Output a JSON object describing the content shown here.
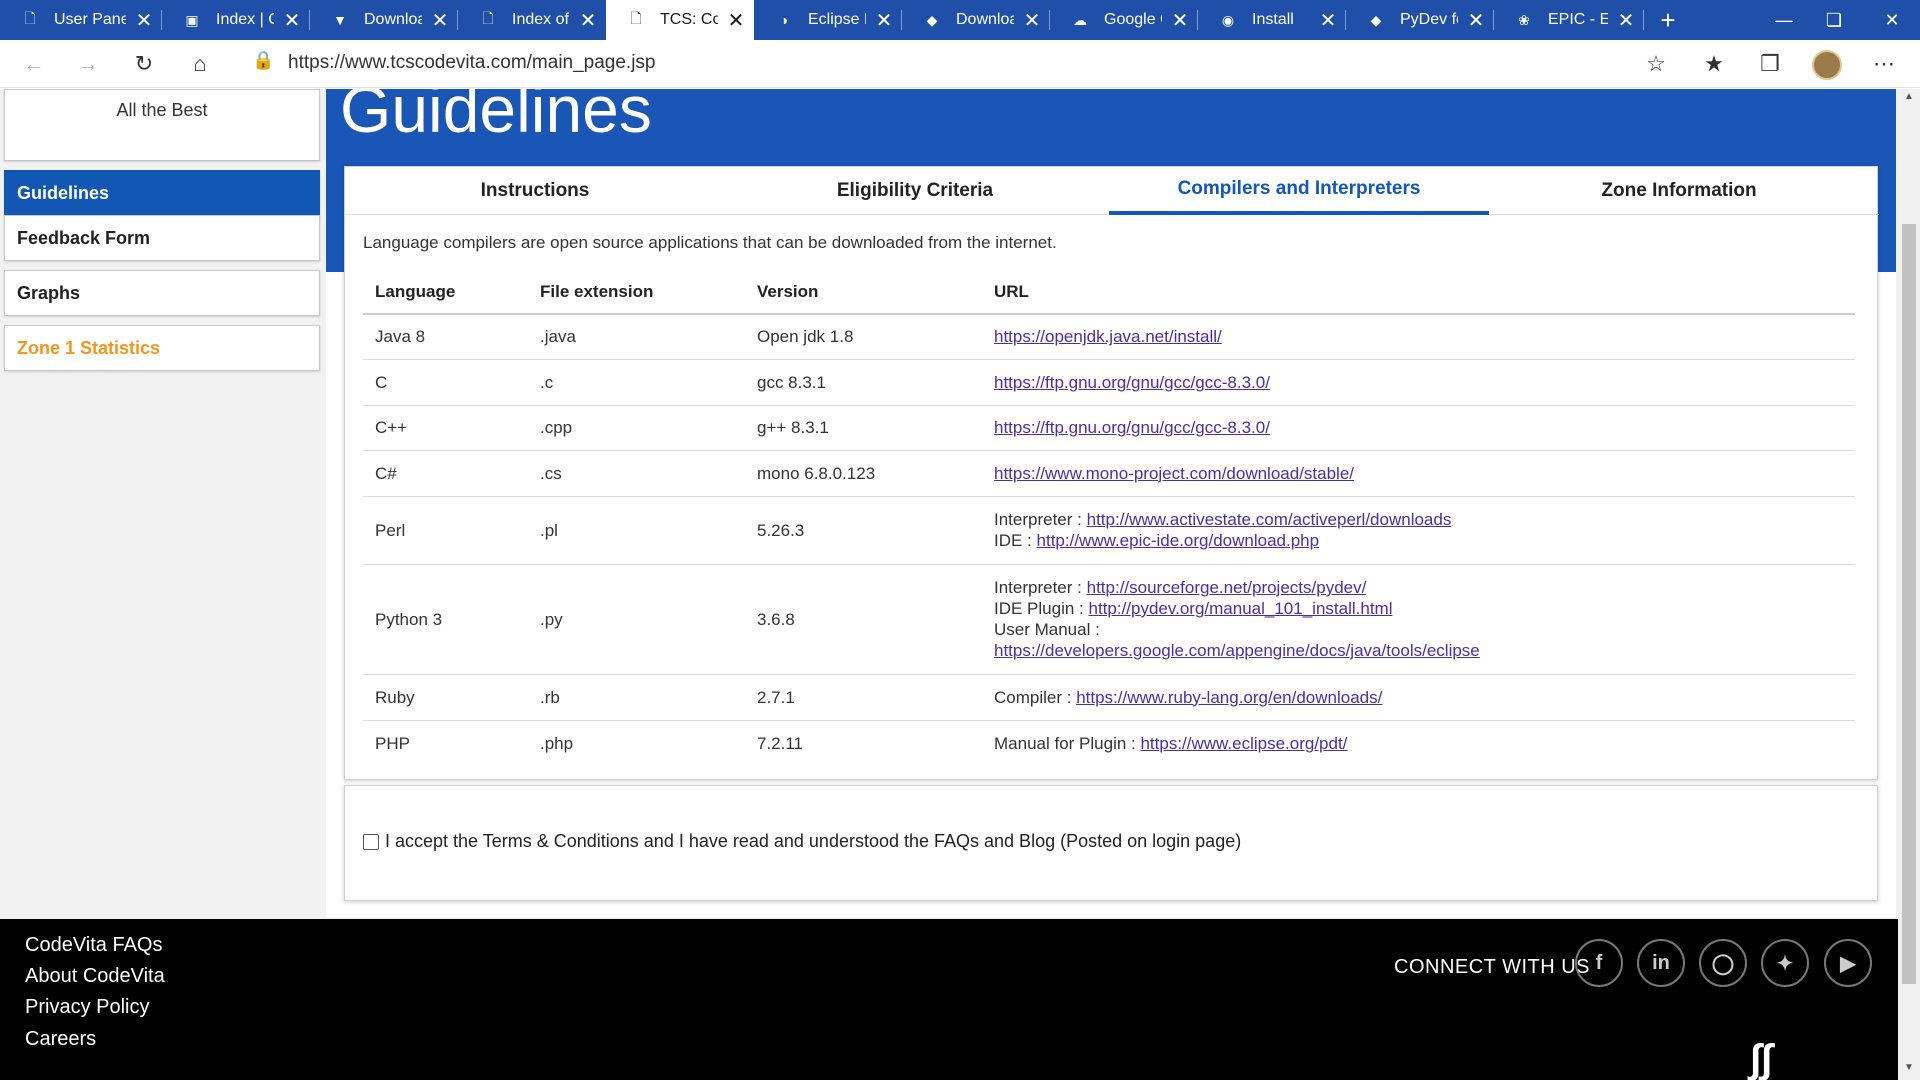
{
  "browser": {
    "tabs": [
      {
        "title": "User Panel",
        "icon": "page-icon"
      },
      {
        "title": "Index | Co",
        "icon": "image-icon"
      },
      {
        "title": "Download",
        "icon": "download-icon"
      },
      {
        "title": "Index of /",
        "icon": "page-icon"
      },
      {
        "title": "TCS: Code",
        "icon": "page-icon"
      },
      {
        "title": "Eclipse PH",
        "icon": "eclipse-icon"
      },
      {
        "title": "Download",
        "icon": "ruby-icon"
      },
      {
        "title": "Google Cl",
        "icon": "cloud-icon"
      },
      {
        "title": "Install",
        "icon": "globe-icon"
      },
      {
        "title": "PyDev for",
        "icon": "pydev-icon"
      },
      {
        "title": "EPIC - Ecl",
        "icon": "leaf-icon"
      }
    ],
    "url": "https://www.tcscodevita.com/main_page.jsp"
  },
  "sidebar": {
    "message": "All the Best",
    "items": [
      "Guidelines",
      "Feedback Form",
      "Graphs",
      "Zone 1 Statistics"
    ]
  },
  "main": {
    "heading": "Guidelines",
    "tabs": [
      "Instructions",
      "Eligibility Criteria",
      "Compilers and Interpreters",
      "Zone Information"
    ],
    "intro": "Language compilers are open source applications that can be downloaded from the internet.",
    "table": {
      "headers": [
        "Language",
        "File extension",
        "Version",
        "URL"
      ],
      "rows": [
        {
          "lang": "Java 8",
          "ext": ".java",
          "ver": "Open jdk 1.8",
          "url": [
            {
              "label": "",
              "link": "https://openjdk.java.net/install/"
            }
          ]
        },
        {
          "lang": "C",
          "ext": ".c",
          "ver": "gcc 8.3.1",
          "url": [
            {
              "label": "",
              "link": "https://ftp.gnu.org/gnu/gcc/gcc-8.3.0/"
            }
          ]
        },
        {
          "lang": "C++",
          "ext": ".cpp",
          "ver": "g++ 8.3.1",
          "url": [
            {
              "label": "",
              "link": "https://ftp.gnu.org/gnu/gcc/gcc-8.3.0/"
            }
          ]
        },
        {
          "lang": "C#",
          "ext": ".cs",
          "ver": "mono 6.8.0.123",
          "url": [
            {
              "label": "",
              "link": "https://www.mono-project.com/download/stable/"
            }
          ]
        },
        {
          "lang": "Perl",
          "ext": ".pl",
          "ver": "5.26.3",
          "url": [
            {
              "label": "Interpreter : ",
              "link": "http://www.activestate.com/activeperl/downloads"
            },
            {
              "label": "IDE : ",
              "link": "http://www.epic-ide.org/download.php"
            }
          ]
        },
        {
          "lang": "Python 3",
          "ext": ".py",
          "ver": "3.6.8",
          "url": [
            {
              "label": "Interpreter : ",
              "link": "http://sourceforge.net/projects/pydev/"
            },
            {
              "label": "IDE Plugin : ",
              "link": "http://pydev.org/manual_101_install.html"
            },
            {
              "label": "User Manual : ",
              "link": "https://developers.google.com/appengine/docs/java/tools/eclipse"
            }
          ]
        },
        {
          "lang": "Ruby",
          "ext": ".rb",
          "ver": "2.7.1",
          "url": [
            {
              "label": "Compiler : ",
              "link": "https://www.ruby-lang.org/en/downloads/"
            }
          ]
        },
        {
          "lang": "PHP",
          "ext": ".php",
          "ver": "7.2.11",
          "url": [
            {
              "label": "Manual for Plugin : ",
              "link": "https://www.eclipse.org/pdt/"
            }
          ]
        }
      ]
    },
    "accept_text": "I accept the Terms & Conditions and I have read and understood the FAQs and Blog (Posted on login page)"
  },
  "footer": {
    "links": [
      "CodeVita FAQs",
      "About CodeVita",
      "Privacy Policy",
      "Careers"
    ],
    "connect": "CONNECT WITH US",
    "social": [
      "facebook-icon",
      "linkedin-icon",
      "instagram-icon",
      "twitter-icon",
      "youtube-icon"
    ]
  }
}
